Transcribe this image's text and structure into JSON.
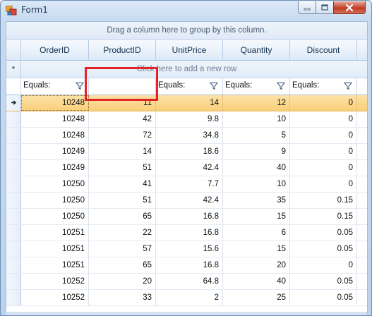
{
  "window": {
    "title": "Form1"
  },
  "grid": {
    "group_panel_text": "Drag a column here to group by this column.",
    "new_row_text": "Click here to add a new row",
    "new_row_marker": "*",
    "columns": [
      "OrderID",
      "ProductID",
      "UnitPrice",
      "Quantity",
      "Discount"
    ],
    "filters": [
      "Equals:",
      "",
      "Equals:",
      "Equals:",
      "Equals:"
    ],
    "rows": [
      [
        "10248",
        "11",
        "14",
        "12",
        "0"
      ],
      [
        "10248",
        "42",
        "9.8",
        "10",
        "0"
      ],
      [
        "10248",
        "72",
        "34.8",
        "5",
        "0"
      ],
      [
        "10249",
        "14",
        "18.6",
        "9",
        "0"
      ],
      [
        "10249",
        "51",
        "42.4",
        "40",
        "0"
      ],
      [
        "10250",
        "41",
        "7.7",
        "10",
        "0"
      ],
      [
        "10250",
        "51",
        "42.4",
        "35",
        "0.15"
      ],
      [
        "10250",
        "65",
        "16.8",
        "15",
        "0.15"
      ],
      [
        "10251",
        "22",
        "16.8",
        "6",
        "0.05"
      ],
      [
        "10251",
        "57",
        "15.6",
        "15",
        "0.05"
      ],
      [
        "10251",
        "65",
        "16.8",
        "20",
        "0"
      ],
      [
        "10252",
        "20",
        "64.8",
        "40",
        "0.05"
      ],
      [
        "10252",
        "33",
        "2",
        "25",
        "0.05"
      ]
    ],
    "current_row_index": 0
  },
  "colors": {
    "current_row": "#f9cf7a",
    "highlight_box": "#e2232a",
    "header_text": "#15324f"
  },
  "icons": {
    "app": "form-icon",
    "filter": "funnel-icon",
    "current_row": "arrow-right-icon",
    "minimize": "minimize-icon",
    "maximize": "maximize-icon",
    "close": "close-icon"
  }
}
